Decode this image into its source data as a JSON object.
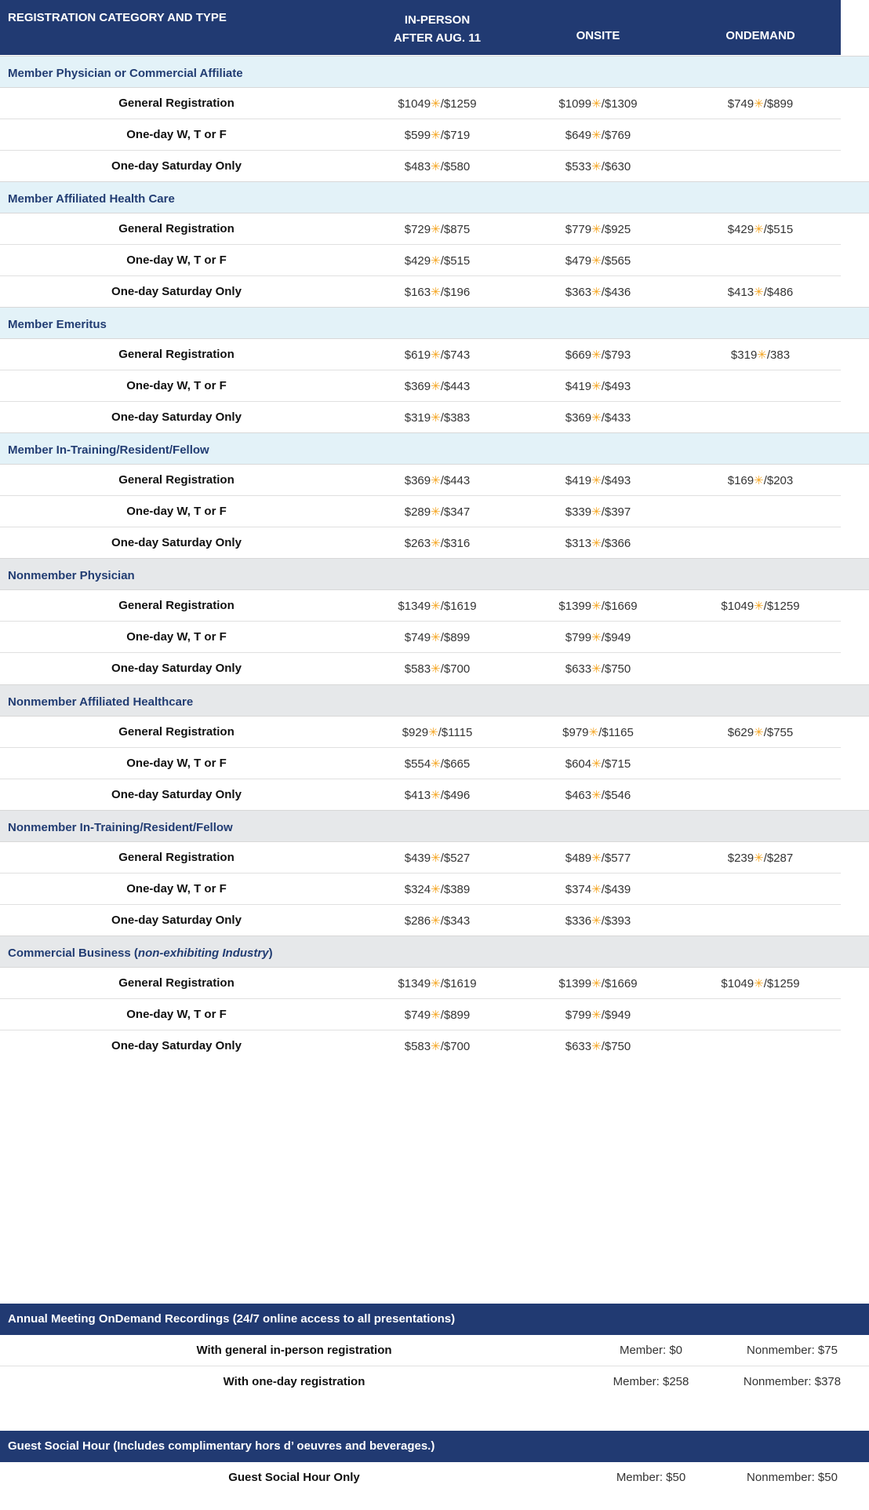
{
  "header": {
    "category": "REGISTRATION CATEGORY AND TYPE",
    "in_person_line1": "IN-PERSON",
    "in_person_line2": "AFTER AUG. 11",
    "onsite": "ONSITE",
    "ondemand": "ONDEMAND"
  },
  "star_icon": "star-icon",
  "star_color": "#f5a623",
  "categories": [
    {
      "name": "Member Physician or Commercial Affiliate",
      "shade": "blue",
      "rows": [
        {
          "label": "General Registration",
          "ip": [
            "$1049",
            "/$1259"
          ],
          "on": [
            "$1099",
            "/$1309"
          ],
          "od": [
            "$749",
            "/$899"
          ]
        },
        {
          "label": "One-day W, T or F",
          "ip": [
            "$599",
            "/$719"
          ],
          "on": [
            "$649",
            "/$769"
          ],
          "od": null
        },
        {
          "label": "One-day Saturday Only",
          "ip": [
            "$483",
            "/$580"
          ],
          "on": [
            "$533",
            "/$630"
          ],
          "od": null
        }
      ]
    },
    {
      "name": "Member Affiliated Health Care",
      "shade": "blue",
      "rows": [
        {
          "label": "General Registration",
          "ip": [
            "$729",
            "/$875"
          ],
          "on": [
            "$779",
            "/$925"
          ],
          "od": [
            "$429",
            "/$515"
          ]
        },
        {
          "label": "One-day W, T or F",
          "ip": [
            "$429",
            "/$515"
          ],
          "on": [
            "$479",
            "/$565"
          ],
          "od": null
        },
        {
          "label": "One-day Saturday Only",
          "ip": [
            "$163",
            "/$196"
          ],
          "on": [
            "$363",
            "/$436"
          ],
          "od": [
            "$413",
            "/$486"
          ]
        }
      ]
    },
    {
      "name": "Member Emeritus",
      "shade": "blue",
      "rows": [
        {
          "label": "General Registration",
          "ip": [
            "$619",
            "/$743"
          ],
          "on": [
            "$669",
            "/$793"
          ],
          "od": [
            "$319",
            "/383"
          ]
        },
        {
          "label": "One-day W, T or F",
          "ip": [
            "$369",
            "/$443"
          ],
          "on": [
            "$419",
            "/$493"
          ],
          "od": null
        },
        {
          "label": "One-day Saturday Only",
          "ip": [
            "$319",
            "/$383"
          ],
          "on": [
            "$369",
            "/$433"
          ],
          "od": null
        }
      ]
    },
    {
      "name": "Member In-Training/Resident/Fellow",
      "shade": "blue",
      "rows": [
        {
          "label": "General Registration",
          "ip": [
            "$369",
            "/$443"
          ],
          "on": [
            "$419",
            "/$493"
          ],
          "od": [
            "$169",
            "/$203"
          ]
        },
        {
          "label": "One-day W, T or F",
          "ip": [
            "$289",
            "/$347"
          ],
          "on": [
            "$339",
            "/$397"
          ],
          "od": null
        },
        {
          "label": "One-day Saturday Only",
          "ip": [
            "$263",
            "/$316"
          ],
          "on": [
            "$313",
            "/$366"
          ],
          "od": null
        }
      ]
    },
    {
      "name": "Nonmember Physician",
      "shade": "grey",
      "rows": [
        {
          "label": "General Registration",
          "ip": [
            "$1349",
            "/$1619"
          ],
          "on": [
            "$1399",
            "/$1669"
          ],
          "od": [
            "$1049",
            "/$1259"
          ]
        },
        {
          "label": "One-day W, T or F",
          "ip": [
            "$749",
            "/$899"
          ],
          "on": [
            "$799",
            "/$949"
          ],
          "od": null
        },
        {
          "label": "One-day Saturday Only",
          "ip": [
            "$583",
            "/$700"
          ],
          "on": [
            "$633",
            "/$750"
          ],
          "od": null
        }
      ]
    },
    {
      "name": "Nonmember Affiliated Healthcare",
      "shade": "grey",
      "rows": [
        {
          "label": "General Registration",
          "ip": [
            "$929",
            "/$1115"
          ],
          "on": [
            "$979",
            "/$1165"
          ],
          "od": [
            "$629",
            "/$755"
          ]
        },
        {
          "label": "One-day W, T or F",
          "ip": [
            "$554",
            "/$665"
          ],
          "on": [
            "$604",
            "/$715"
          ],
          "od": null
        },
        {
          "label": "One-day Saturday Only",
          "ip": [
            "$413",
            "/$496"
          ],
          "on": [
            "$463",
            "/$546"
          ],
          "od": null
        }
      ]
    },
    {
      "name": "Nonmember In-Training/Resident/Fellow",
      "shade": "grey",
      "rows": [
        {
          "label": "General Registration",
          "ip": [
            "$439",
            "/$527"
          ],
          "on": [
            "$489",
            "/$577"
          ],
          "od": [
            "$239",
            "/$287"
          ]
        },
        {
          "label": "One-day W, T or F",
          "ip": [
            "$324",
            "/$389"
          ],
          "on": [
            "$374",
            "/$439"
          ],
          "od": null
        },
        {
          "label": "One-day Saturday Only",
          "ip": [
            "$286",
            "/$343"
          ],
          "on": [
            "$336",
            "/$393"
          ],
          "od": null
        }
      ]
    },
    {
      "name": "Commercial Business (",
      "name_italic": "non-exhibiting Industry",
      "name_suffix": ")",
      "shade": "grey",
      "rows": [
        {
          "label": "General Registration",
          "ip": [
            "$1349",
            "/$1619"
          ],
          "on": [
            "$1399",
            "/$1669"
          ],
          "od": [
            "$1049",
            "/$1259"
          ]
        },
        {
          "label": "One-day W, T or F",
          "ip": [
            "$749",
            "/$899"
          ],
          "on": [
            "$799",
            "/$949"
          ],
          "od": null
        },
        {
          "label": "One-day Saturday Only",
          "ip": [
            "$583",
            "/$700"
          ],
          "on": [
            "$633",
            "/$750"
          ],
          "od": null
        }
      ]
    }
  ],
  "recordings": {
    "title": "Annual Meeting OnDemand Recordings (24/7 online access to all presentations)",
    "rows": [
      {
        "label": "With general in-person registration",
        "member": "Member: $0",
        "nonmember": "Nonmember: $75"
      },
      {
        "label": "With one-day registration",
        "member": "Member: $258",
        "nonmember": "Nonmember: $378"
      }
    ]
  },
  "social": {
    "title": "Guest Social Hour (Includes complimentary hors d’ oeuvres and beverages.)",
    "rows": [
      {
        "label": "Guest Social Hour Only",
        "member": "Member: $50",
        "nonmember": "Nonmember: $50"
      }
    ]
  }
}
